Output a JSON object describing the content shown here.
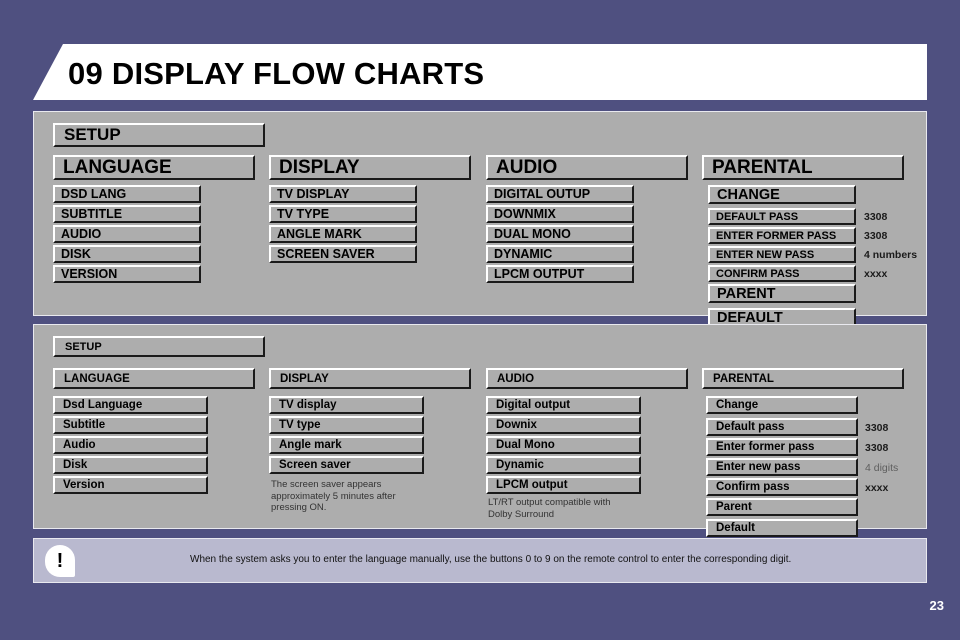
{
  "header": {
    "chapter_number": "09",
    "title": "DISPLAY FLOW CHARTS"
  },
  "upper_chart": {
    "root": "SETUP",
    "columns": [
      {
        "head": "LANGUAGE",
        "items": [
          "DSD LANG",
          "SUBTITLE",
          "AUDIO",
          "DISK",
          "VERSION"
        ]
      },
      {
        "head": "DISPLAY",
        "items": [
          "TV DISPLAY",
          "TV TYPE",
          "ANGLE MARK",
          "SCREEN SAVER"
        ]
      },
      {
        "head": "AUDIO",
        "items": [
          "DIGITAL OUTUP",
          "DOWNMIX",
          "DUAL MONO",
          "DYNAMIC",
          "LPCM OUTPUT"
        ]
      },
      {
        "head": "PARENTAL",
        "change": "CHANGE",
        "pass_rows": [
          {
            "label": "DEFAULT PASS",
            "value": "3308"
          },
          {
            "label": "ENTER FORMER PASS",
            "value": "3308"
          },
          {
            "label": "ENTER NEW PASS",
            "value": "4 numbers"
          },
          {
            "label": "CONFIRM PASS",
            "value": "xxxx"
          }
        ],
        "parent": "PARENT",
        "default": "DEFAULT"
      }
    ]
  },
  "lower_chart": {
    "root": "SETUP",
    "columns": [
      {
        "head": "LANGUAGE",
        "items": [
          "Dsd Language",
          "Subtitle",
          "Audio",
          "Disk",
          "Version"
        ]
      },
      {
        "head": "DISPLAY",
        "items": [
          "TV display",
          "TV type",
          "Angle mark",
          "Screen saver"
        ],
        "note": "The screen saver appears\napproximately 5 minutes after\npressing ON."
      },
      {
        "head": "AUDIO",
        "items": [
          "Digital output",
          "Downix",
          "Dual Mono",
          "Dynamic",
          "LPCM output"
        ],
        "note": "LT/RT output compatible with\nDolby Surround"
      },
      {
        "head": "PARENTAL",
        "change": "Change",
        "pass_rows": [
          {
            "label": "Default pass",
            "value": "3308"
          },
          {
            "label": "Enter former pass",
            "value": "3308"
          },
          {
            "label": "Enter new pass",
            "value": "4 digits"
          },
          {
            "label": "Confirm pass",
            "value": "xxxx"
          }
        ],
        "parent": "Parent",
        "default": "Default"
      }
    ]
  },
  "callout": {
    "icon": "!",
    "text": "When the system asks you to enter the language manually, use the buttons 0 to 9 on the remote control to enter the corresponding digit."
  },
  "page_number": "23",
  "colors": {
    "background": "#4f5080",
    "panel": "#adadad",
    "header_bar": "#ffffff",
    "callout": "#b9b9cf"
  }
}
